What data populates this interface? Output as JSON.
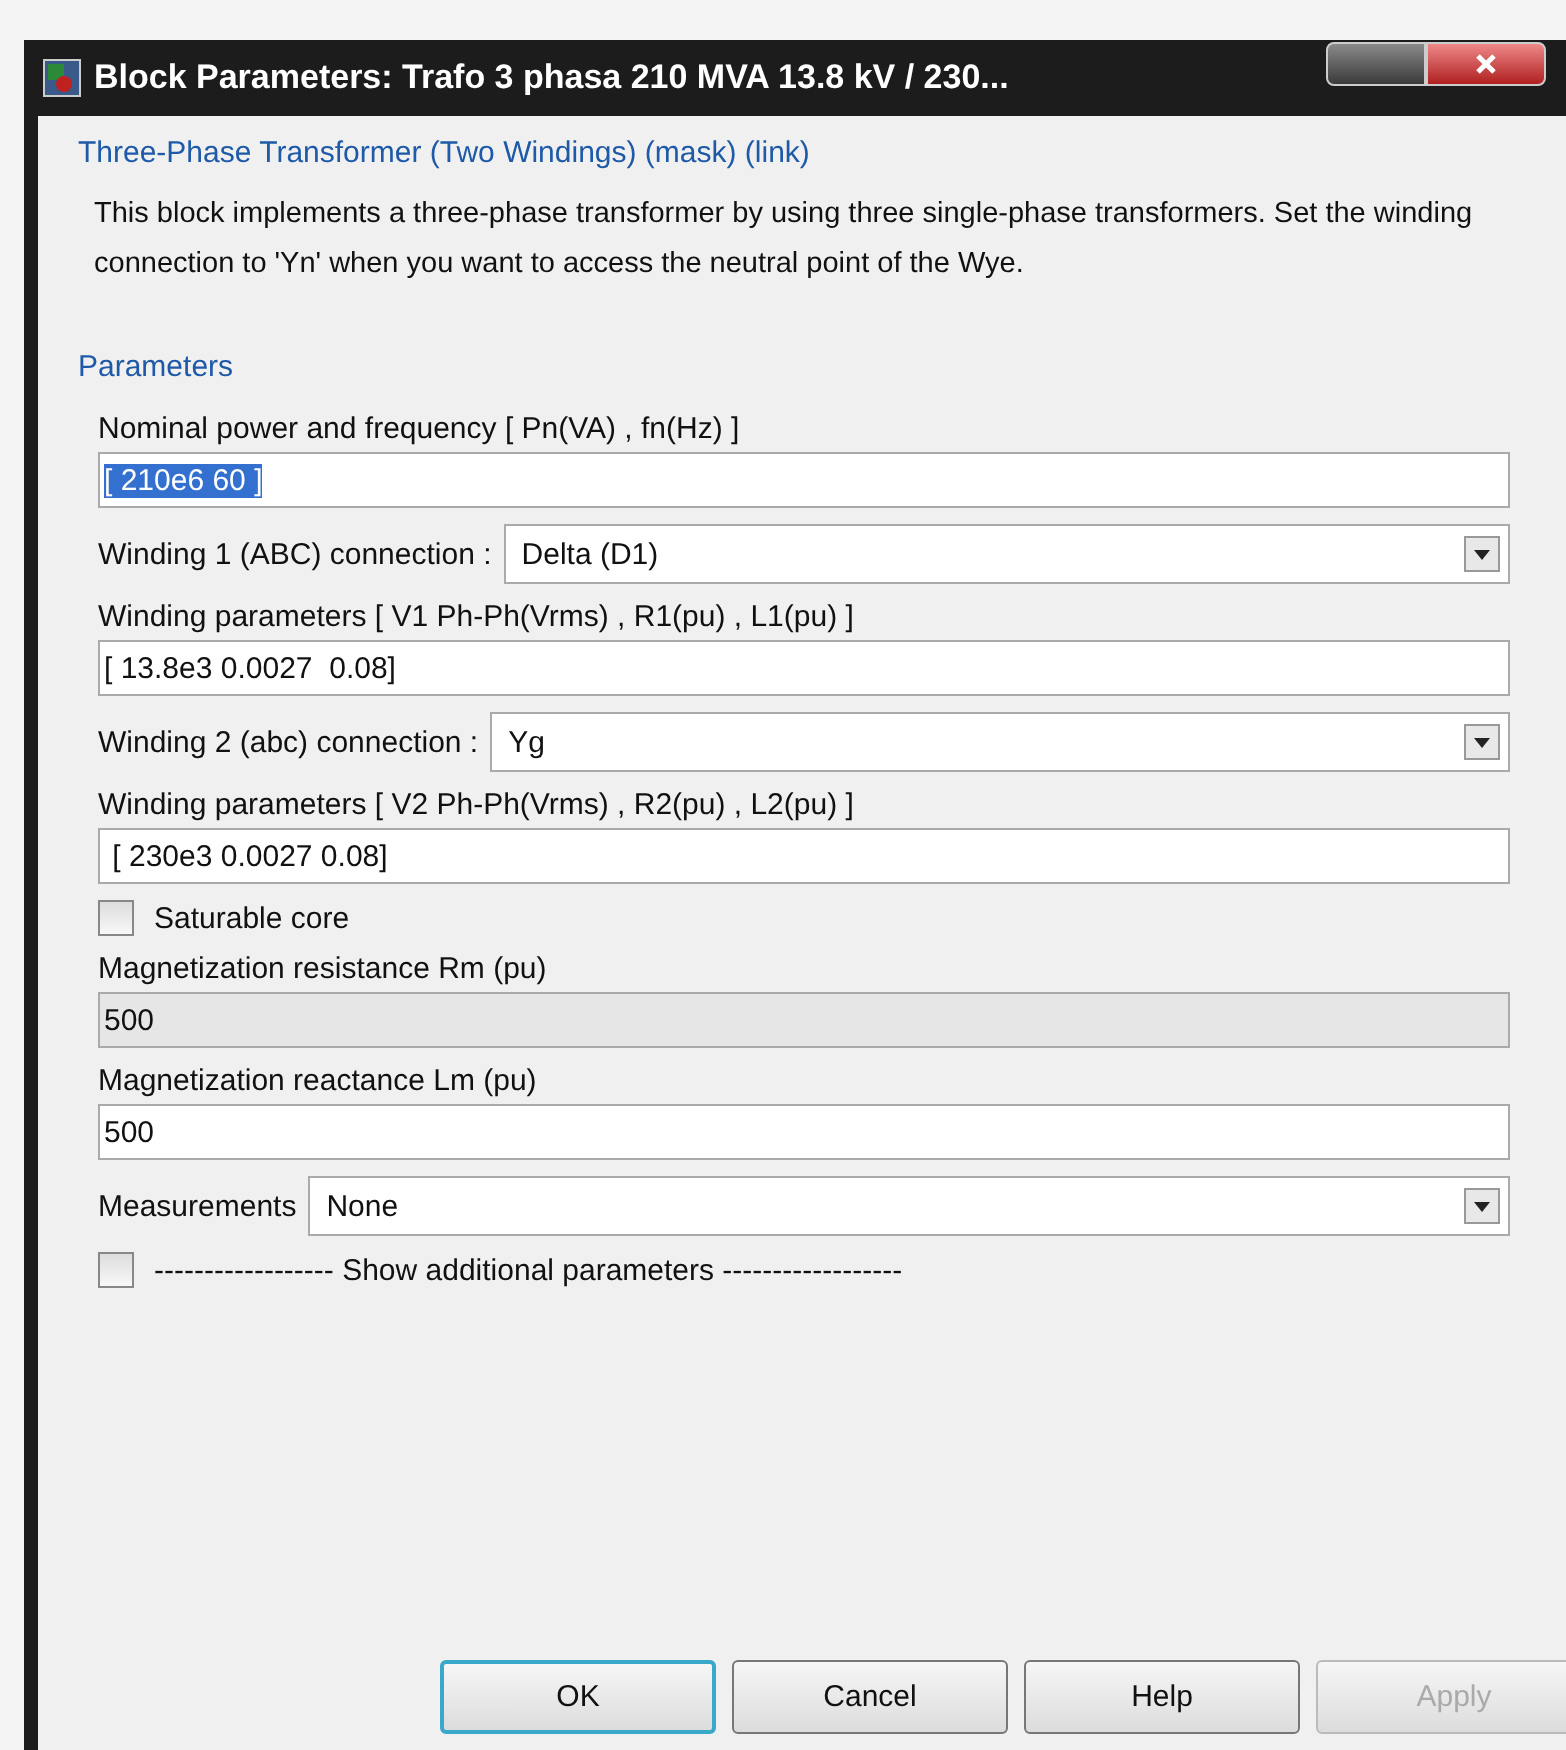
{
  "window": {
    "title": "Block Parameters: Trafo 3 phasa 210 MVA 13.8 kV / 230..."
  },
  "header": {
    "title": "Three-Phase Transformer (Two Windings) (mask) (link)",
    "description": "This block implements a three-phase transformer by using three single-phase transformers. Set the winding connection to 'Yn'  when you want to access the neutral point of the Wye."
  },
  "parameters": {
    "title": "Parameters",
    "items": [
      {
        "kind": "text",
        "label": "Nominal power and frequency  [ Pn(VA) , fn(Hz) ]",
        "value": "[ 210e6 60 ]",
        "selected": true,
        "disabled": false
      },
      {
        "kind": "dropdown",
        "label": "Winding 1 (ABC) connection :",
        "value": "Delta (D1)"
      },
      {
        "kind": "text",
        "label": "Winding parameters [ V1 Ph-Ph(Vrms) , R1(pu) , L1(pu) ]",
        "value": "[ 13.8e3 0.0027  0.08]",
        "selected": false,
        "disabled": false
      },
      {
        "kind": "dropdown",
        "label": "Winding 2 (abc) connection :",
        "value": "Yg"
      },
      {
        "kind": "text",
        "label": "Winding parameters [ V2 Ph-Ph(Vrms) , R2(pu) , L2(pu) ]",
        "value": " [ 230e3 0.0027 0.08]",
        "selected": false,
        "disabled": false
      },
      {
        "kind": "checkbox",
        "label": "Saturable core",
        "checked": false
      },
      {
        "kind": "text",
        "label": "Magnetization resistance  Rm (pu)",
        "value": "500",
        "selected": false,
        "disabled": true
      },
      {
        "kind": "text",
        "label": "Magnetization reactance Lm (pu)",
        "value": "500",
        "selected": false,
        "disabled": false
      },
      {
        "kind": "dropdown",
        "label": "Measurements",
        "value": "None"
      },
      {
        "kind": "checkbox",
        "label": "------------------ Show additional parameters ------------------",
        "checked": false
      }
    ]
  },
  "buttons": [
    {
      "label": "OK",
      "default": true,
      "disabled": false
    },
    {
      "label": "Cancel",
      "default": false,
      "disabled": false
    },
    {
      "label": "Help",
      "default": false,
      "disabled": false
    },
    {
      "label": "Apply",
      "default": false,
      "disabled": true
    }
  ]
}
